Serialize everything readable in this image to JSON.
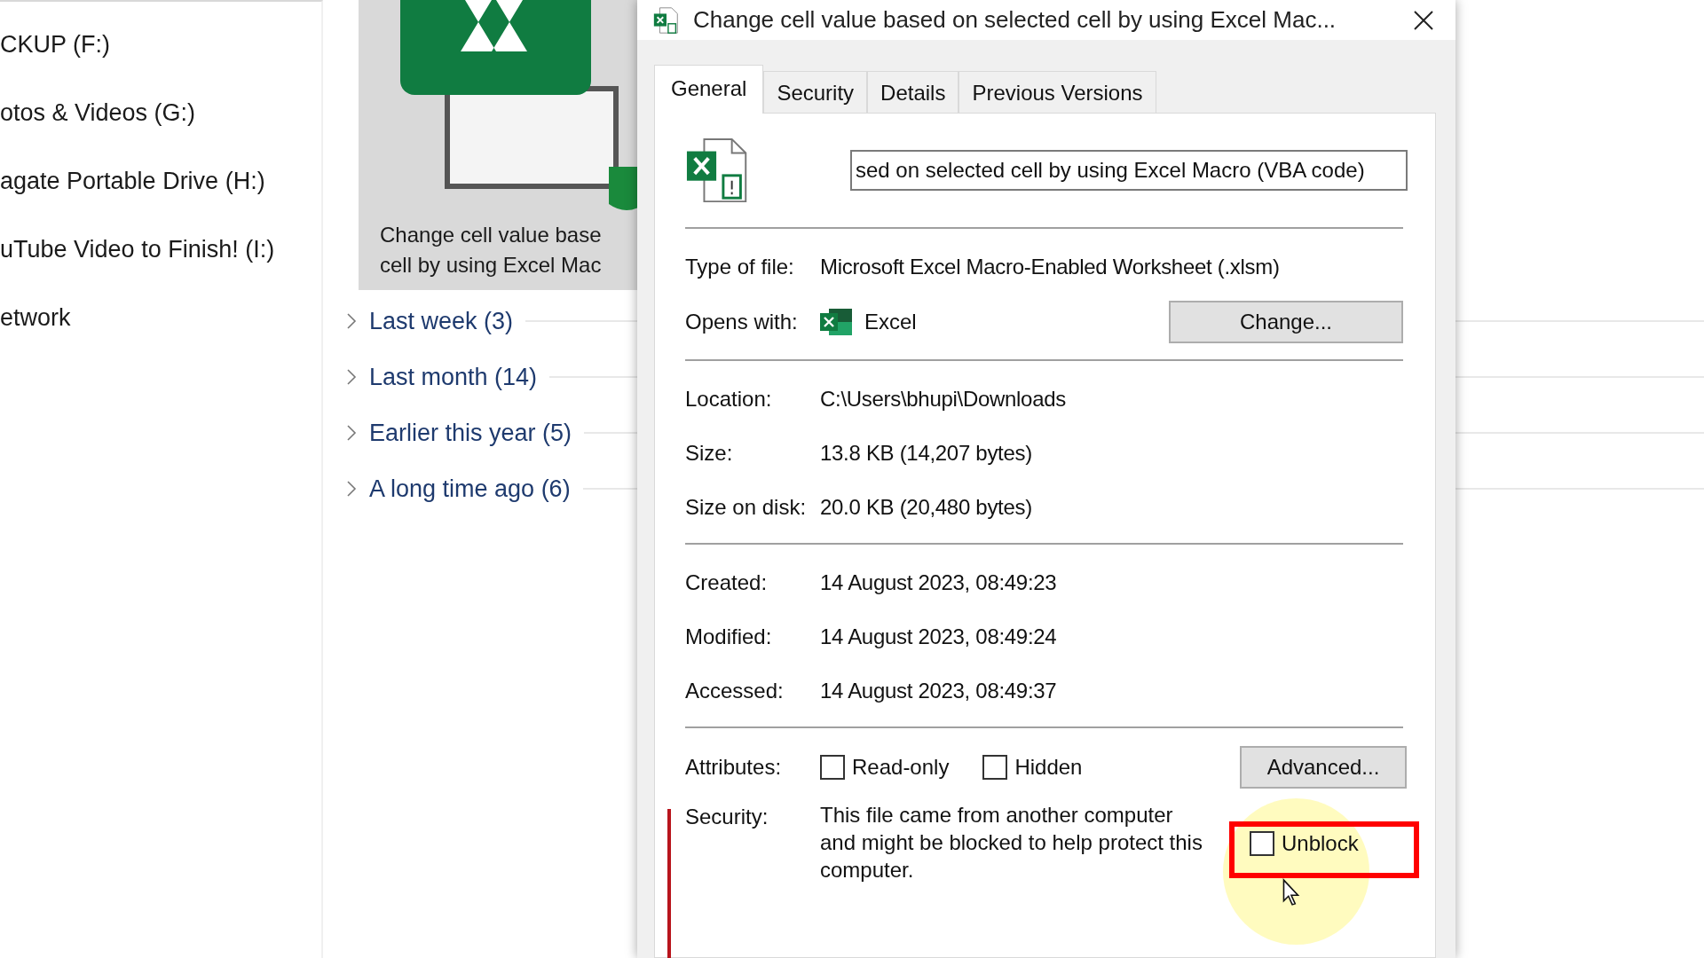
{
  "navigation_pane": {
    "items": [
      {
        "label": "CKUP (F:)"
      },
      {
        "label": "otos & Videos (G:)"
      },
      {
        "label": "agate Portable Drive (H:)"
      },
      {
        "label": "uTube Video to Finish! (I:)"
      },
      {
        "label": "etwork"
      }
    ]
  },
  "file_tile": {
    "selected": true,
    "caption_lines": [
      "Change cell value base",
      "cell by using Excel Mac"
    ]
  },
  "groups": [
    {
      "label": "Last week (3)",
      "expanded": false
    },
    {
      "label": "Last month (14)",
      "expanded": false
    },
    {
      "label": "Earlier this year (5)",
      "expanded": false
    },
    {
      "label": "A long time ago (6)",
      "expanded": false
    }
  ],
  "dialog": {
    "title": "Change cell value based on selected cell by using Excel Mac...",
    "tabs": [
      {
        "label": "General",
        "selected": true
      },
      {
        "label": "Security",
        "selected": false
      },
      {
        "label": "Details",
        "selected": false
      },
      {
        "label": "Previous Versions",
        "selected": false
      }
    ],
    "file_name": {
      "value": "sed on selected cell by using Excel Macro (VBA code)"
    },
    "type_of_file": {
      "label": "Type of file:",
      "value": "Microsoft Excel Macro-Enabled Worksheet (.xlsm)"
    },
    "opens_with": {
      "label": "Opens with:",
      "app": "Excel",
      "button": "Change..."
    },
    "file_info": [
      {
        "label": "Location:",
        "value": "C:\\Users\\bhupi\\Downloads"
      },
      {
        "label": "Size:",
        "value": "13.8 KB (14,207 bytes)"
      },
      {
        "label": "Size on disk:",
        "value": "20.0 KB (20,480 bytes)"
      }
    ],
    "dates": [
      {
        "label": "Created:",
        "value": "14 August 2023, 08:49:23"
      },
      {
        "label": "Modified:",
        "value": "14 August 2023, 08:49:24"
      },
      {
        "label": "Accessed:",
        "value": "14 August 2023, 08:49:37"
      }
    ],
    "attributes": {
      "label": "Attributes:",
      "options": [
        {
          "label": "Read-only",
          "checked": false
        },
        {
          "label": "Hidden",
          "checked": false
        }
      ],
      "button": "Advanced..."
    },
    "security": {
      "label": "Security:",
      "text": "This file came from another computer and might be blocked to help protect this computer.",
      "option": {
        "label": "Unblock",
        "checked": false
      }
    }
  }
}
